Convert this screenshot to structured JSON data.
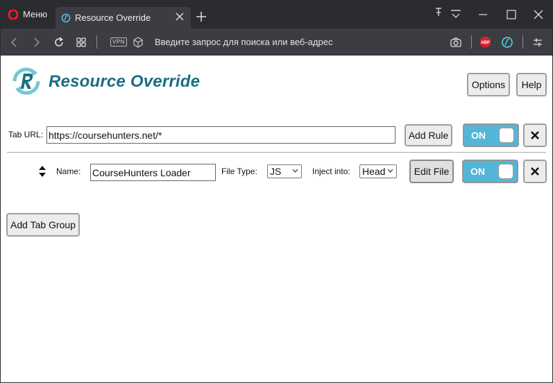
{
  "browser": {
    "menu_label": "Меню",
    "tab_title": "Resource Override",
    "address_placeholder": "Введите запрос для поиска или веб-адрес",
    "vpn_label": "VPN",
    "abp_label": "ABP"
  },
  "app": {
    "title": "Resource Override",
    "options_label": "Options",
    "help_label": "Help",
    "add_tab_group_label": "Add Tab Group"
  },
  "tab_group": {
    "url_label": "Tab URL:",
    "url_value": "https://coursehunters.net/*",
    "add_rule_label": "Add Rule",
    "toggle_label": "ON"
  },
  "rule": {
    "name_label": "Name:",
    "name_value": "CourseHunters Loader",
    "file_type_label": "File Type:",
    "file_type_value": "JS",
    "inject_label": "Inject into:",
    "inject_value": "Head",
    "edit_file_label": "Edit File",
    "toggle_label": "ON"
  },
  "colors": {
    "accent": "#1b6d82",
    "toggle_on": "#52b7d6",
    "chrome_dark": "#2b2c30",
    "chrome_bar": "#3c3d42"
  }
}
